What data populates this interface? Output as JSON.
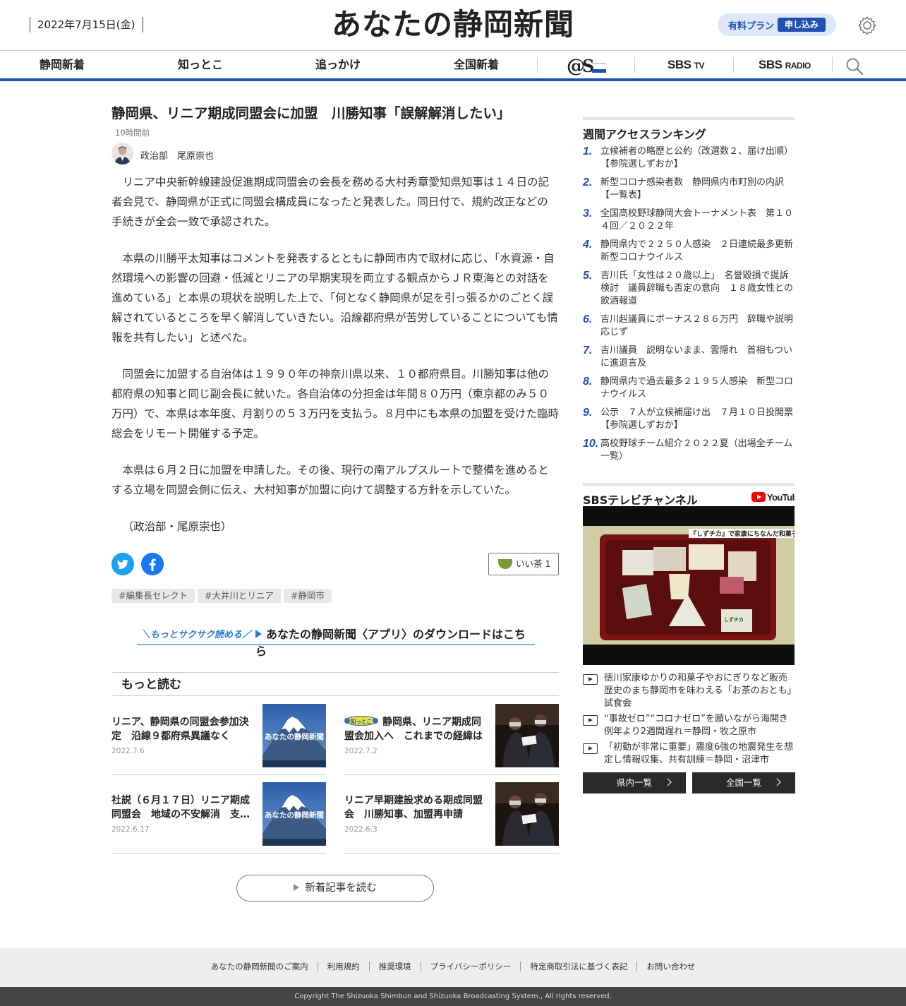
{
  "header": {
    "date": "2022年7月15日(金)",
    "logo": "あなたの静岡新聞",
    "plan_label": "有料プラン",
    "plan_button": "申し込み"
  },
  "nav": {
    "items": [
      "静岡新着",
      "知っとこ",
      "追っかけ",
      "全国新着"
    ],
    "sbs_tv": "SBS",
    "sbs_tv_suffix": "TV",
    "sbs_radio": "SBS",
    "sbs_radio_suffix": "RADIO"
  },
  "article": {
    "title": "静岡県、リニア期成同盟会に加盟　川勝知事「誤解解消したい」",
    "time_ago": "10時間前",
    "author": "政治部　尾原崇也",
    "paragraphs": [
      "リニア中央新幹線建設促進期成同盟会の会長を務める大村秀章愛知県知事は１４日の記者会見で、静岡県が正式に同盟会構成員になったと発表した。同日付で、規約改正などの手続きが全会一致で承認された。",
      "本県の川勝平太知事はコメントを発表するとともに静岡市内で取材に応じ、「水資源・自然環境への影響の回避・低減とリニアの早期実現を両立する観点からＪＲ東海との対話を進めている」と本県の現状を説明した上で、「何となく静岡県が足を引っ張るかのごとく誤解されているところを早く解消していきたい。沿線都府県が苦労していることについても情報を共有したい」と述べた。",
      "同盟会に加盟する自治体は１９９０年の神奈川県以来、１０都府県目。川勝知事は他の都府県の知事と同じ副会長に就いた。各自治体の分担金は年間８０万円（東京都のみ５０万円）で、本県は本年度、月割りの５３万円を支払う。８月中にも本県の加盟を受けた臨時総会をリモート開催する予定。",
      "本県は６月２日に加盟を申請した。その後、現行の南アルプスルートで整備を進めるとする立場を同盟会側に伝え、大村知事が加盟に向けて調整する方針を示していた。",
      "（政治部・尾原崇也）"
    ],
    "iicha_label": "いい茶",
    "iicha_count": "1",
    "tags": [
      "#編集長セレクト",
      "#大井川とリニア",
      "#静岡市"
    ],
    "app_lead": "＼もっとサクサク読める／",
    "app_text": "あなたの静岡新聞〈アプリ〉のダウンロードはこちら"
  },
  "more": {
    "heading": "もっと読む",
    "cards": [
      {
        "title": "リニア、静岡県の同盟会参加決定　沿線９都府県異議なく",
        "date": "2022.7.6",
        "image": "fuji",
        "badge": false
      },
      {
        "title": "静岡県、リニア期成同盟会加入へ　これまでの経緯は",
        "date": "2022.7.2",
        "image": "handover",
        "badge": true,
        "badge_text": "知っとこ"
      },
      {
        "title": "社説（６月１７日）リニア期成同盟会　地域の不安解消　支…",
        "date": "2022.6.17",
        "image": "fuji",
        "badge": false
      },
      {
        "title": "リニア早期建設求める期成同盟会　川勝知事、加盟再申請",
        "date": "2022.6.3",
        "image": "handover",
        "badge": false
      }
    ],
    "fuji_caption": "あなたの静岡新聞",
    "read_more": "新着記事を読む"
  },
  "ranking": {
    "heading": "週間アクセスランキング",
    "items": [
      {
        "rank": "1.",
        "title": "立候補者の略歴と公約（改選数２、届け出順）【参院選しずおか】"
      },
      {
        "rank": "2.",
        "title": "新型コロナ感染者数　静岡県内市町別の内訳【一覧表】"
      },
      {
        "rank": "3.",
        "title": "全国高校野球静岡大会トーナメント表　第１０４回／２０２２年"
      },
      {
        "rank": "4.",
        "title": "静岡県内で２２５０人感染　２日連続最多更新　新型コロナウイルス"
      },
      {
        "rank": "5.",
        "title": "吉川氏「女性は２０歳以上」　名誉毀損で提訴検討　議員辞職も否定の意向　１８歳女性との飲酒報道"
      },
      {
        "rank": "6.",
        "title": "吉川赳議員にボーナス２８６万円　辞職や説明応じず"
      },
      {
        "rank": "7.",
        "title": "吉川議員　説明ないまま、雲隠れ　首相もついに進退言及"
      },
      {
        "rank": "8.",
        "title": "静岡県内で過去最多２１９５人感染　新型コロナウイルス"
      },
      {
        "rank": "9.",
        "title": "公示　７人が立候補届け出　７月１０日投開票【参院選しずおか】"
      },
      {
        "rank": "10.",
        "title": "高校野球チーム紹介２０２２夏（出場全チーム一覧）"
      }
    ]
  },
  "sbs_channel": {
    "heading": "SBSテレビチャンネル",
    "youtube_label": "YouTube",
    "video_caption": "『しずチカ』で家康にちなんだ和菓子」販売",
    "video_logo": "しずチカ",
    "videos": [
      "徳川家康ゆかりの和菓子やおにぎりなど販売　歴史のまち静岡市を味わえる「お茶のおとも」試食会",
      "“事故ゼロ”“コロナゼロ”を願いながら海開き　例年より2週間遅れ＝静岡・牧之原市",
      "「初動が非常に重要」震度6強の地震発生を想定し情報収集、共有訓練＝静岡・沼津市"
    ],
    "btn_local": "県内一覧",
    "btn_national": "全国一覧"
  },
  "footer": {
    "links": [
      "あなたの静岡新聞のご案内",
      "利用規約",
      "推奨環境",
      "プライバシーポリシー",
      "特定商取引法に基づく表記",
      "お問い合わせ"
    ],
    "copyright": "Copyright The Shizuoka Shimbun and Shizuoka Broadcasting System., All rights reserved."
  },
  "colors": {
    "brand": "#1f4fb0",
    "rank": "#1f4fb0",
    "twitter": "#1da1f2",
    "facebook": "#1877f2"
  },
  "icons": [
    "gear-icon",
    "search-icon",
    "twitter-icon",
    "facebook-icon",
    "tea-cup-icon",
    "play-icon",
    "youtube-icon",
    "chevron-right-icon"
  ]
}
